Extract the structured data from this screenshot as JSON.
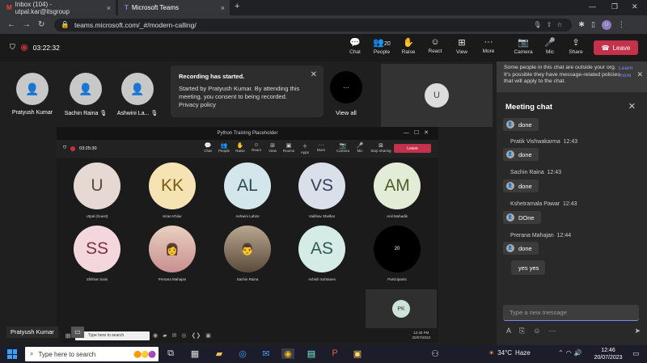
{
  "browser": {
    "tabs": [
      {
        "label": "Inbox (104) - utpal.kar@itsgroup",
        "close": "×"
      },
      {
        "label": "Microsoft Teams",
        "close": "×"
      }
    ],
    "new_tab": "+",
    "url": "teams.microsoft.com/_#/modern-calling/",
    "profile_initial": "U"
  },
  "meeting": {
    "elapsed": "03:22:32",
    "controls": [
      {
        "label": "Chat",
        "icon": "💬"
      },
      {
        "label": "People",
        "icon": "👥",
        "badge": "20"
      },
      {
        "label": "Raise",
        "icon": "✋"
      },
      {
        "label": "React",
        "icon": "☺"
      },
      {
        "label": "View",
        "icon": "⊞"
      },
      {
        "label": "More",
        "icon": "···"
      },
      {
        "label": "Camera",
        "icon": "📷"
      },
      {
        "label": "Mic",
        "icon": "🎤"
      },
      {
        "label": "Share",
        "icon": "⇪"
      }
    ],
    "leave": "Leave"
  },
  "participants": [
    {
      "name": "Pratyush Kumar"
    },
    {
      "name": "Sachin Raina"
    },
    {
      "name": "Ashwini La..."
    }
  ],
  "view_all": {
    "label": "View all",
    "icon": "···"
  },
  "self_initial": "U",
  "toast": {
    "title": "Recording has started.",
    "body": "Started by Pratyush Kumar. By attending this meeting, you consent to being recorded.",
    "link": "Privacy policy"
  },
  "shared_screen": {
    "title": "Python Training Placeholder",
    "elapsed": "03:25:30",
    "controls": [
      "Chat",
      "People",
      "Raise",
      "React",
      "View",
      "Rooms",
      "Apps",
      "More",
      "Camera",
      "Mic",
      "Stop sharing"
    ],
    "leave": "Leave",
    "tiles": [
      {
        "initials": "U",
        "name": "Utpal (Guest)",
        "bg": "#e6d9d3",
        "fg": "#5a4a3f"
      },
      {
        "initials": "KK",
        "name": "Kiran Khilur",
        "bg": "#f6e3b4",
        "fg": "#7a5c12"
      },
      {
        "initials": "AL",
        "name": "Ashwini Lahire",
        "bg": "#d3e6ec",
        "fg": "#2c4a55"
      },
      {
        "initials": "VS",
        "name": "Vaibhav Shelkar",
        "bg": "#d9e0ea",
        "fg": "#33425a"
      },
      {
        "initials": "AM",
        "name": "Anil Mahadik",
        "bg": "#e3ecd6",
        "fg": "#4d5e2f"
      },
      {
        "initials": "SS",
        "name": "Shikhar Saini",
        "bg": "#f3d7dc",
        "fg": "#7a3240"
      },
      {
        "initials": "",
        "name": "Prerana Mahajan",
        "bg": "#c98f8f",
        "fg": "#fff"
      },
      {
        "initials": "",
        "name": "Sachin Raina",
        "bg": "#8a7a6a",
        "fg": "#fff"
      },
      {
        "initials": "AS",
        "name": "Ashish Sohtanes",
        "bg": "#d5ebe6",
        "fg": "#2f5a52"
      },
      {
        "initials": "20",
        "name": "Participants",
        "bg": "#000000",
        "fg": "#fff"
      }
    ],
    "self_initials": "PK",
    "taskbar_search": "Type here to search",
    "clock_time": "12:45 PM",
    "clock_date": "20/07/2023"
  },
  "name_label": "Pratyush Kumar",
  "chat": {
    "notice": "Some people in this chat are outside your org. It's possible they have message-related policies that will apply to the chat.",
    "learn_more": "Learn more",
    "title": "Meeting chat",
    "messages": [
      {
        "sender": "",
        "time": "",
        "text": "done"
      },
      {
        "sender": "Pratik Vishwakarma",
        "time": "12:43",
        "text": "done"
      },
      {
        "sender": "Sachin Raina",
        "time": "12:43",
        "text": "done"
      },
      {
        "sender": "Kshetramala Pawar",
        "time": "12:43",
        "text": "DOne"
      },
      {
        "sender": "Prerana Mahajan",
        "time": "12:44",
        "text": "done"
      },
      {
        "sender": "",
        "time": "",
        "text": "yes yes"
      }
    ],
    "compose_placeholder": "Type a new message"
  },
  "taskbar": {
    "search_placeholder": "Type here to search",
    "temperature": "34°C",
    "weather": "Haze",
    "time": "12:46",
    "date": "20/07/2023"
  },
  "colors": {
    "leave": "#c4314b",
    "accent": "#7f85f5"
  }
}
